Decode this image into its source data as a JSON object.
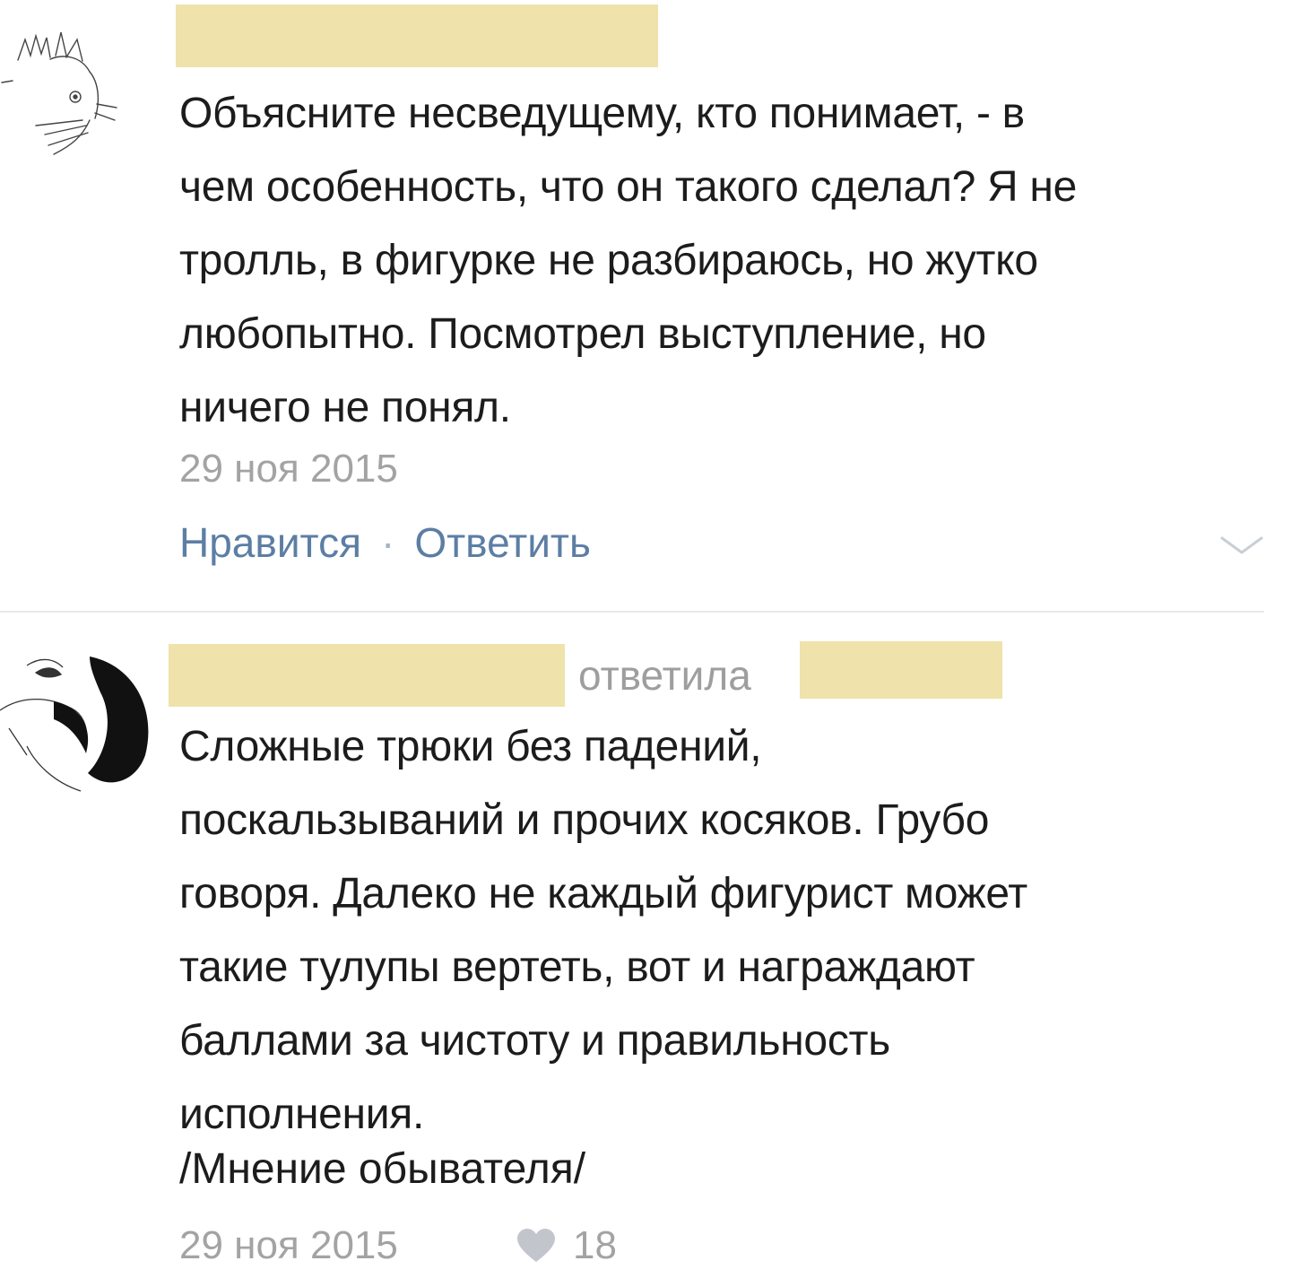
{
  "comment1": {
    "text": "Объясните несведущему, кто понимает, - в\nчем особенность, что он такого сделал? Я не\nтролль, в фигурке не разбираюсь, но жутко\nлюбопытно. Посмотрел выступление, но\nничего не понял.",
    "date": "29 ноя 2015",
    "like_label": "Нравится",
    "reply_label": "Ответить",
    "separator": "·"
  },
  "comment2": {
    "replied_label": "ответила",
    "text": "Сложные трюки без падений,\nпоскальзываний и прочих косяков. Грубо\nговоря. Далеко не каждый фигурист может\nтакие тулупы вертеть, вот и награждают\nбаллами за чистоту и правильность\nисполнения.",
    "signature": "/Мнение обывателя/",
    "date": "29 ноя 2015",
    "likes": "18"
  },
  "icons": {
    "like": "heart-icon",
    "expand": "chevron-down-icon"
  },
  "colors": {
    "redaction": "#efe2aa",
    "link": "#5c7ea4",
    "muted": "#a3a3a3"
  }
}
